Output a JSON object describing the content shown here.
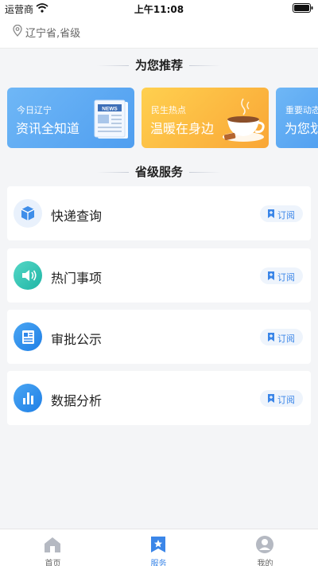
{
  "status_bar": {
    "carrier": "运营商",
    "time": "上午11:08"
  },
  "location": {
    "text": "辽宁省,省级"
  },
  "recommend": {
    "title": "为您推荐",
    "cards": [
      {
        "small": "今日辽宁",
        "big": "资讯全知道",
        "badge": "NEWS"
      },
      {
        "small": "民生热点",
        "big": "温暖在身边"
      },
      {
        "small": "重要动态",
        "big": "为您划"
      }
    ]
  },
  "services": {
    "title": "省级服务",
    "items": [
      {
        "label": "快递查询",
        "action": "订阅"
      },
      {
        "label": "热门事项",
        "action": "订阅"
      },
      {
        "label": "审批公示",
        "action": "订阅"
      },
      {
        "label": "数据分析",
        "action": "订阅"
      }
    ]
  },
  "tabbar": {
    "items": [
      {
        "label": "首页"
      },
      {
        "label": "服务"
      },
      {
        "label": "我的"
      }
    ],
    "active": "服务"
  },
  "colors": {
    "accent": "#3b86e8",
    "blue_card": "#5aa8f3",
    "orange_card": "#fbb840"
  }
}
